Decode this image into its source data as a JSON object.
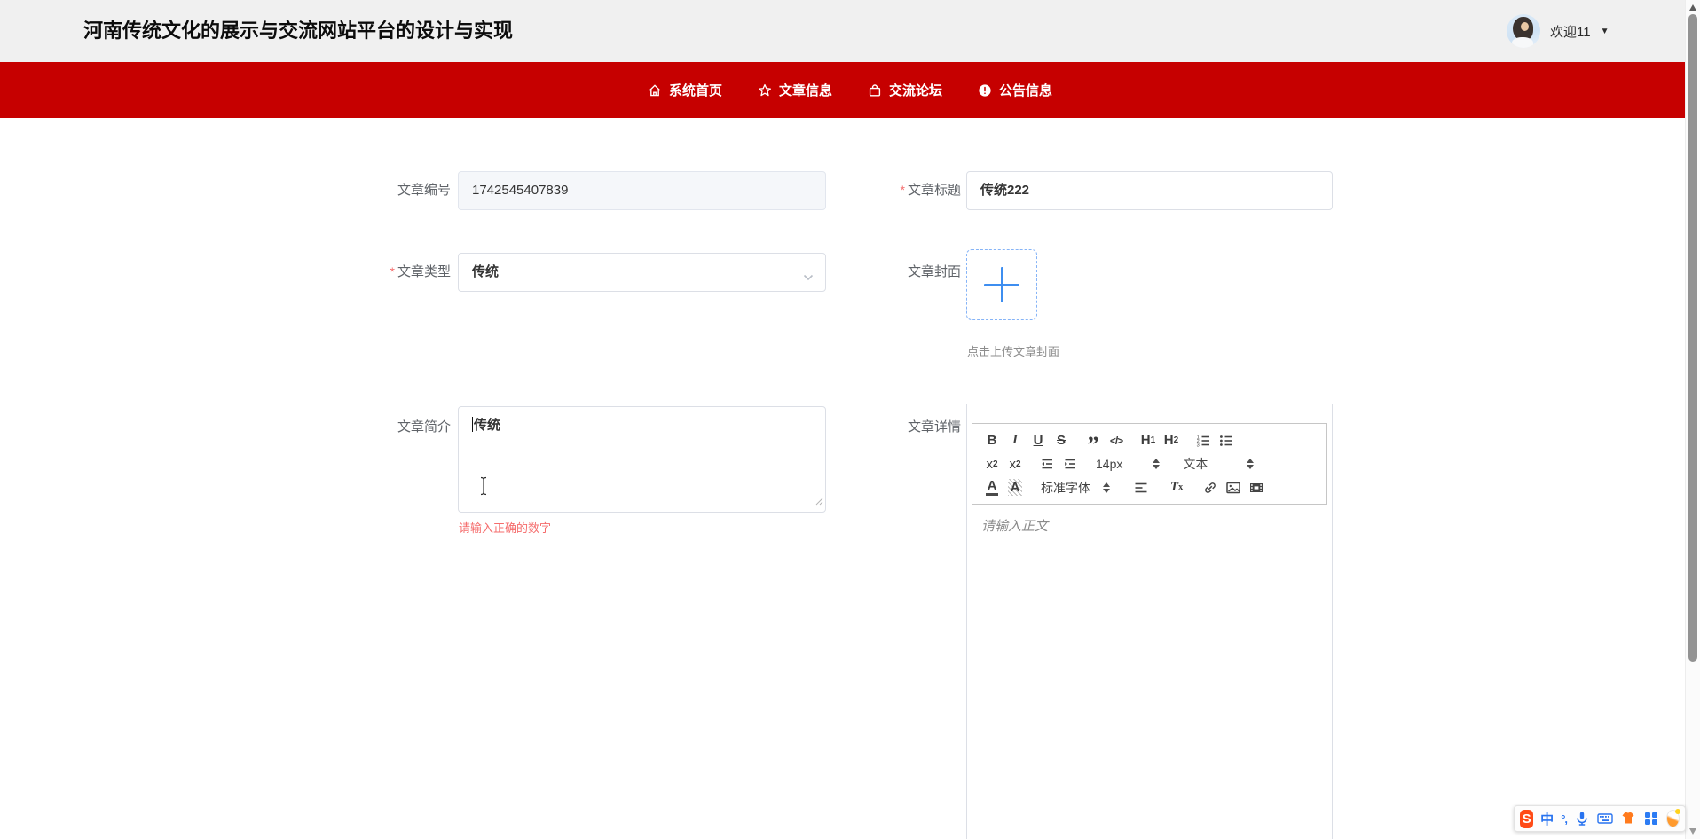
{
  "header": {
    "title": "河南传统文化的展示与交流网站平台的设计与实现",
    "welcome": "欢迎11",
    "dropdown_arrow": "▼"
  },
  "nav": {
    "items": [
      {
        "label": "系统首页",
        "icon": "home-icon"
      },
      {
        "label": "文章信息",
        "icon": "star-icon"
      },
      {
        "label": "交流论坛",
        "icon": "bag-icon"
      },
      {
        "label": "公告信息",
        "icon": "info-icon"
      }
    ]
  },
  "form": {
    "article_id": {
      "label": "文章编号",
      "value": "1742545407839"
    },
    "article_title": {
      "label": "文章标题",
      "required_mark": "*",
      "value": "传统222"
    },
    "article_type": {
      "label": "文章类型",
      "required_mark": "*",
      "value": "传统"
    },
    "article_cover": {
      "label": "文章封面",
      "upload_hint": "点击上传文章封面"
    },
    "article_intro": {
      "label": "文章简介",
      "value": "传统",
      "error": "请输入正确的数字"
    },
    "article_detail": {
      "label": "文章详情",
      "placeholder": "请输入正文"
    }
  },
  "editor_toolbar": {
    "bold": "B",
    "italic": "I",
    "underline": "U",
    "strike": "S",
    "quote": "”",
    "code": "</>",
    "h1_main": "H",
    "h1_sub": "1",
    "h2_main": "H",
    "h2_sub": "2",
    "subscript_main": "x",
    "subscript_sub": "2",
    "superscript_main": "x",
    "superscript_sup": "2",
    "size_value": "14px",
    "header_value": "文本",
    "font_value": "标准字体",
    "color_letter": "A",
    "background_letter": "A",
    "clean_main": "T",
    "clean_sub": "x"
  },
  "ime_bar": {
    "logo": "S",
    "mode": "中",
    "punct": "°,"
  },
  "colors": {
    "nav_red": "#c60000",
    "accent_blue": "#409eff",
    "error_red": "#f56c6c",
    "header_gray": "#f0f0f0",
    "input_border": "#dcdfe6",
    "disabled_input_bg": "#f5f7fa"
  }
}
